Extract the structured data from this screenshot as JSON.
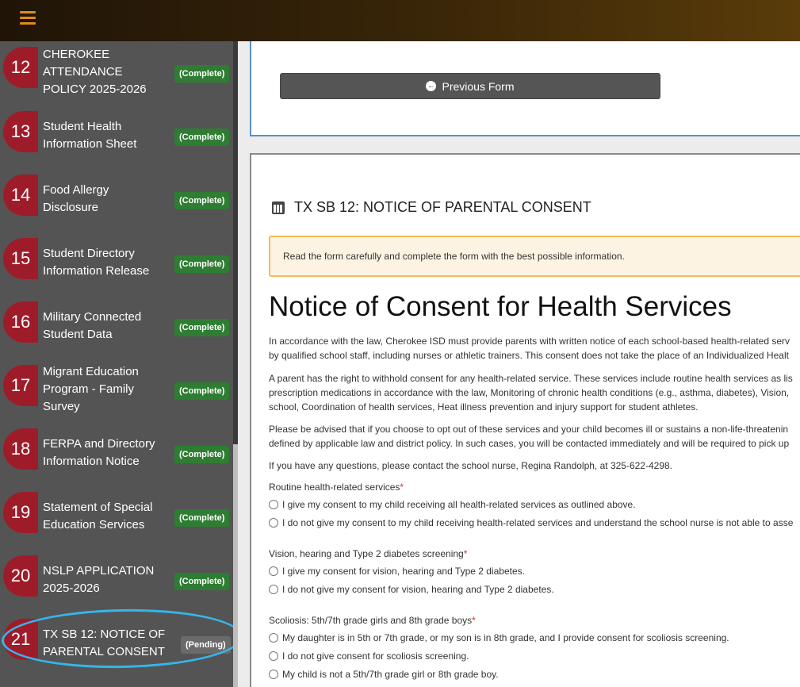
{
  "sidebar": {
    "items": [
      {
        "num": "12",
        "label": "CHEROKEE ATTENDANCE POLICY 2025-2026",
        "lines": [
          "CHEROKEE",
          "ATTENDANCE",
          "POLICY 2025-2026"
        ],
        "status": "(Complete)"
      },
      {
        "num": "13",
        "lines": [
          "Student Health",
          "Information Sheet"
        ],
        "status": "(Complete)"
      },
      {
        "num": "14",
        "lines": [
          "Food Allergy",
          "Disclosure"
        ],
        "status": "(Complete)"
      },
      {
        "num": "15",
        "lines": [
          "Student Directory",
          "Information Release"
        ],
        "status": "(Complete)"
      },
      {
        "num": "16",
        "lines": [
          "Military Connected",
          "Student Data"
        ],
        "status": "(Complete)"
      },
      {
        "num": "17",
        "lines": [
          "Migrant Education",
          "Program - Family",
          "Survey"
        ],
        "status": "(Complete)"
      },
      {
        "num": "18",
        "lines": [
          "FERPA and Directory",
          "Information Notice"
        ],
        "status": "(Complete)"
      },
      {
        "num": "19",
        "lines": [
          "Statement of Special",
          "Education Services"
        ],
        "status": "(Complete)"
      },
      {
        "num": "20",
        "lines": [
          "NSLP APPLICATION",
          "2025-2026"
        ],
        "status": "(Complete)"
      },
      {
        "num": "21",
        "lines": [
          "TX SB 12: NOTICE OF",
          "PARENTAL CONSENT"
        ],
        "status": "(Pending)"
      }
    ]
  },
  "nav": {
    "previous_label": "Previous Form"
  },
  "form": {
    "header": "TX SB 12: NOTICE OF PARENTAL CONSENT",
    "notice": "Read the form carefully and complete the form with the best possible information.",
    "title": "Notice of Consent for Health Services",
    "paragraphs": [
      [
        "In accordance with the law, Cherokee ISD must provide parents with written notice of each school-based health-related serv",
        "by qualified school staff, including nurses or athletic trainers. This consent does not take the place of an Individualized Healt"
      ],
      [
        "A parent has the right to withhold consent for any health-related service. These services include routine health services as lis",
        "prescription medications in accordance with the law, Monitoring of chronic health conditions (e.g., asthma, diabetes), Vision,",
        "school, Coordination of health services, Heat illness prevention and injury support for student athletes."
      ],
      [
        "Please be advised that if you choose to opt out of these services and your child becomes ill or sustains a non-life-threatenin",
        "defined by applicable law and district policy. In such cases, you will be contacted immediately and will be required to pick up"
      ],
      [
        "If you have any questions, please contact the school nurse, Regina Randolph, at 325-622-4298."
      ]
    ],
    "questions": [
      {
        "label": "Routine health-related services",
        "options": [
          "I give my consent to my child receiving all health-related services as outlined above.",
          "I do not give my consent to my child receiving health-related services and understand the school nurse is not able to asse"
        ]
      },
      {
        "label": "Vision, hearing and Type 2 diabetes screening",
        "options": [
          "I give my consent for vision, hearing and Type 2 diabetes.",
          "I do not give my consent for vision, hearing and Type 2 diabetes."
        ]
      },
      {
        "label": "Scoliosis: 5th/7th grade girls and 8th grade boys",
        "options": [
          "My daughter is in 5th or 7th grade, or my son is in 8th grade, and I provide consent for scoliosis screening.",
          "I do not give consent for scoliosis screening.",
          "My child is not a 5th/7th grade girl or 8th grade boy."
        ]
      }
    ],
    "required_mark": "*"
  }
}
